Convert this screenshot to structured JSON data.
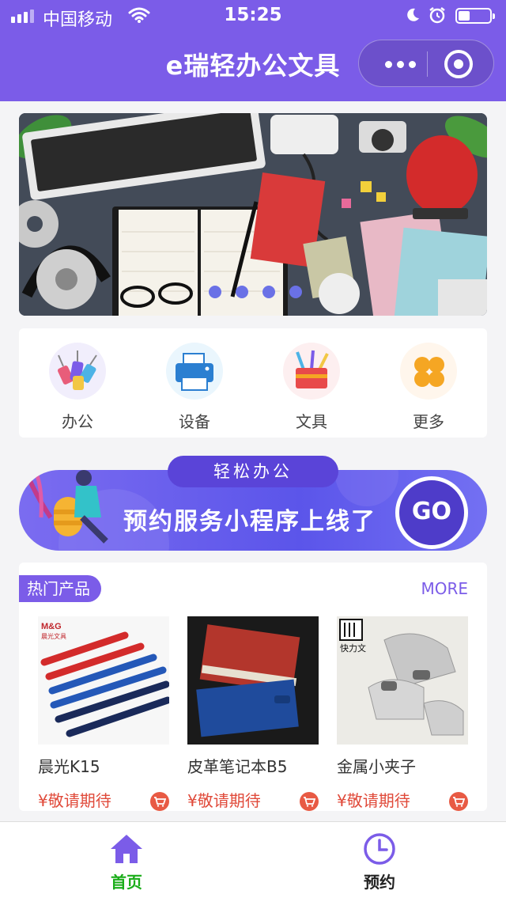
{
  "status_bar": {
    "carrier": "中国移动",
    "time": "15:25"
  },
  "header": {
    "title": "e瑞轻办公文具"
  },
  "banner": {
    "slide_count": 4,
    "active_index": 3
  },
  "categories": [
    {
      "label": "办公",
      "icon": "paper-clips-icon"
    },
    {
      "label": "设备",
      "icon": "printer-icon"
    },
    {
      "label": "文具",
      "icon": "pen-holder-icon"
    },
    {
      "label": "更多",
      "icon": "more-grid-icon"
    }
  ],
  "promo": {
    "tag": "轻松办公",
    "headline": "预约服务小程序上线了",
    "button": "GO"
  },
  "hot": {
    "title": "热门产品",
    "more": "MORE",
    "products": [
      {
        "name": "晨光K15",
        "price": "¥敬请期待",
        "image_label": "M&G 晨光文具"
      },
      {
        "name": "皮革笔记本B5",
        "price": "¥敬请期待",
        "image_label": ""
      },
      {
        "name": "金属小夹子",
        "price": "¥敬请期待",
        "image_label": "快力文"
      }
    ]
  },
  "tabbar": {
    "items": [
      {
        "label": "首页",
        "icon": "home-icon",
        "active": true
      },
      {
        "label": "预约",
        "icon": "clock-icon",
        "active": false
      }
    ]
  },
  "colors": {
    "brand": "#7b5ce8",
    "price": "#e04a3a",
    "active_tab": "#1aad19"
  }
}
